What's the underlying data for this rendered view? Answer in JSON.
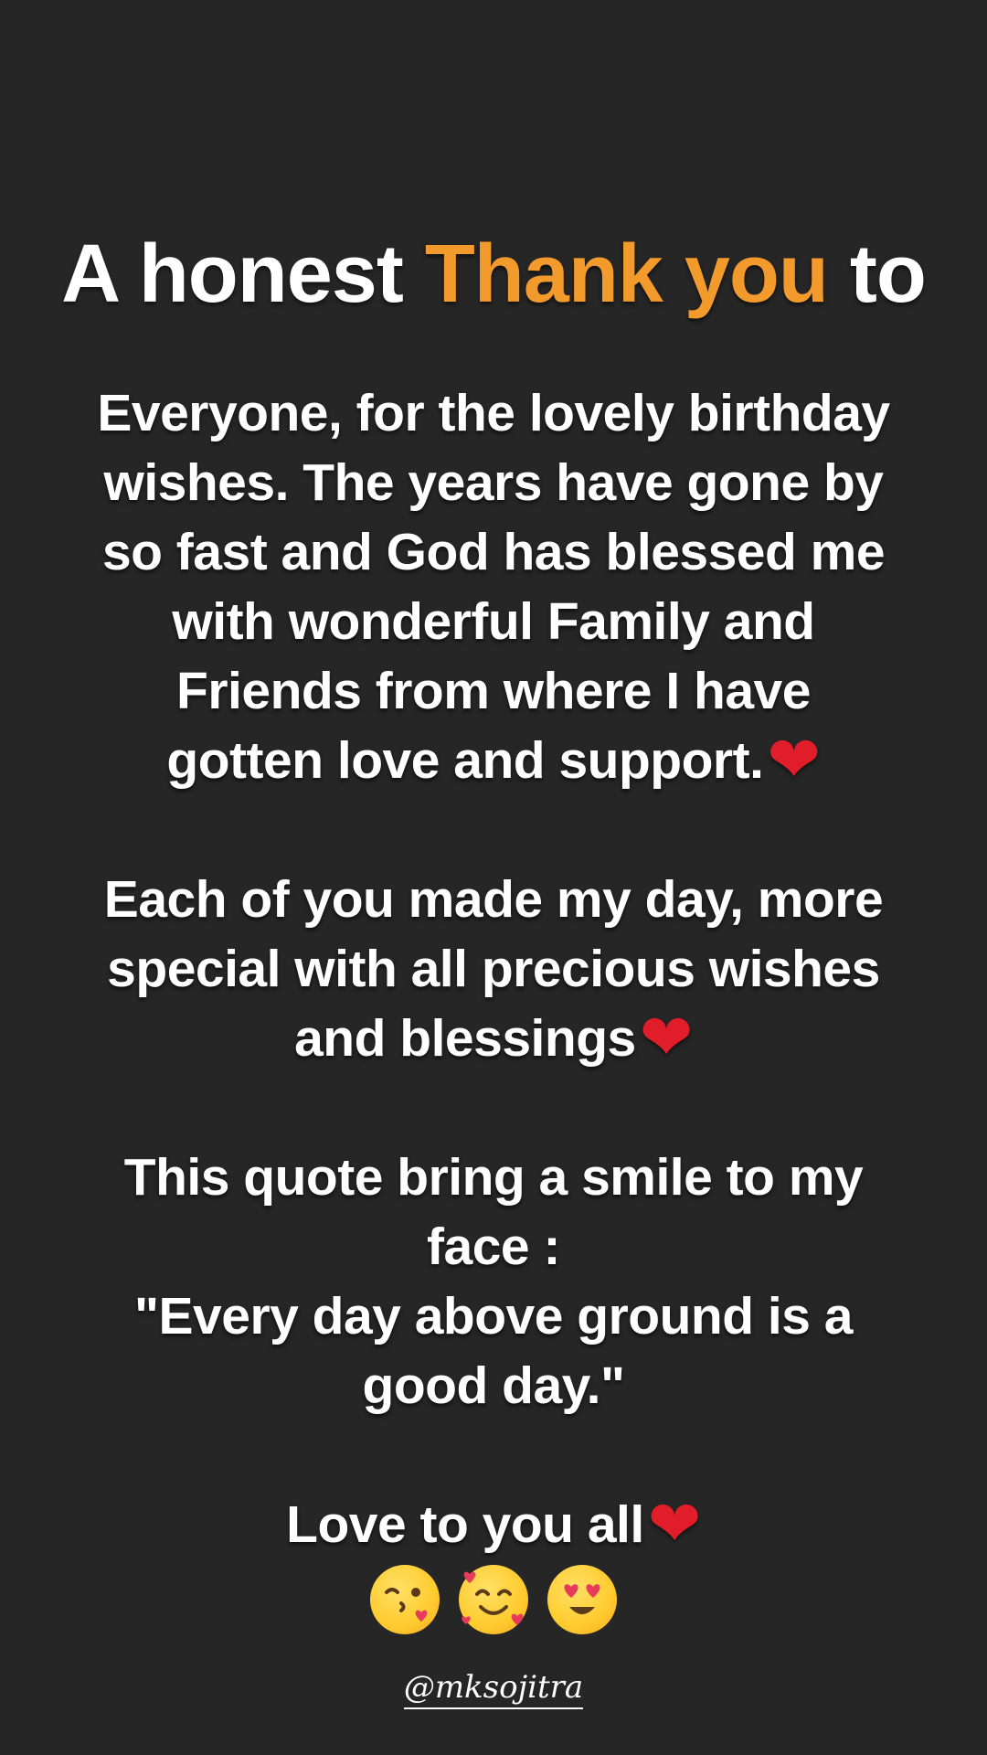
{
  "headline": {
    "before": "A honest ",
    "accent": "Thank you",
    "after": " to",
    "accent_color": "#f39a2d"
  },
  "paragraph1": [
    "Everyone, for the lovely birthday",
    "wishes. The years have gone by",
    "so fast and God has blessed me",
    "with wonderful Family and",
    "Friends from where I have",
    "gotten love and support."
  ],
  "paragraph2": [
    "Each of you made my day, more",
    "special with all precious wishes",
    "and blessings"
  ],
  "paragraph3": [
    "This quote bring a smile to my",
    "face :",
    "\"Every day above ground is a",
    "good day.\""
  ],
  "paragraph4": "Love to you all",
  "emojis": [
    "face-blowing-kiss-icon",
    "smiling-face-with-hearts-icon",
    "heart-eyes-icon"
  ],
  "handle": "@mksojitra",
  "colors": {
    "background": "#262626",
    "text": "#ffffff",
    "heart": "#e11d2a"
  }
}
